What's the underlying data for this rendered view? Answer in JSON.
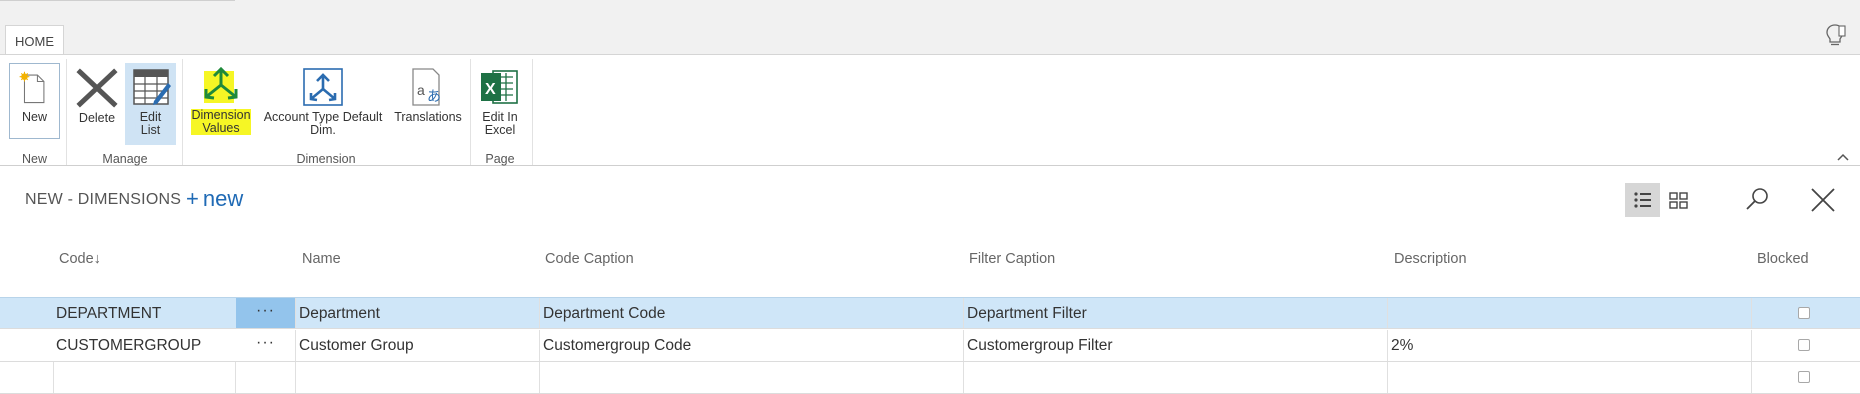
{
  "ribbon": {
    "tab": "HOME",
    "buttons": {
      "new": "New",
      "delete": "Delete",
      "edit_list": "Edit\nList",
      "dimension_values": "Dimension\nValues",
      "account_type_default_dim": "Account Type Default\nDim.",
      "translations": "Translations",
      "edit_in_excel": "Edit In\nExcel"
    },
    "groups": {
      "new": "New",
      "manage": "Manage",
      "dimension": "Dimension",
      "page": "Page"
    }
  },
  "page": {
    "title": "NEW - DIMENSIONS",
    "new_link": "new"
  },
  "table": {
    "columns": {
      "code": "Code",
      "name": "Name",
      "code_caption": "Code Caption",
      "filter_caption": "Filter Caption",
      "description": "Description",
      "blocked": "Blocked"
    },
    "rows": [
      {
        "code": "DEPARTMENT",
        "name": "Department",
        "code_caption": "Department Code",
        "filter_caption": "Department Filter",
        "description": "",
        "blocked": false
      },
      {
        "code": "CUSTOMERGROUP",
        "name": "Customer Group",
        "code_caption": "Customergroup Code",
        "filter_caption": "Customergroup Filter",
        "description": "2%",
        "blocked": false
      },
      {
        "code": "",
        "name": "",
        "code_caption": "",
        "filter_caption": "",
        "description": "",
        "blocked": false
      }
    ],
    "row_menu_glyph": "···",
    "sort_glyph": "↓"
  },
  "colors": {
    "accent": "#1f6ab5",
    "selected_row": "#cfe6f8",
    "highlight": "#f6f625",
    "excel_green": "#1e7145"
  }
}
